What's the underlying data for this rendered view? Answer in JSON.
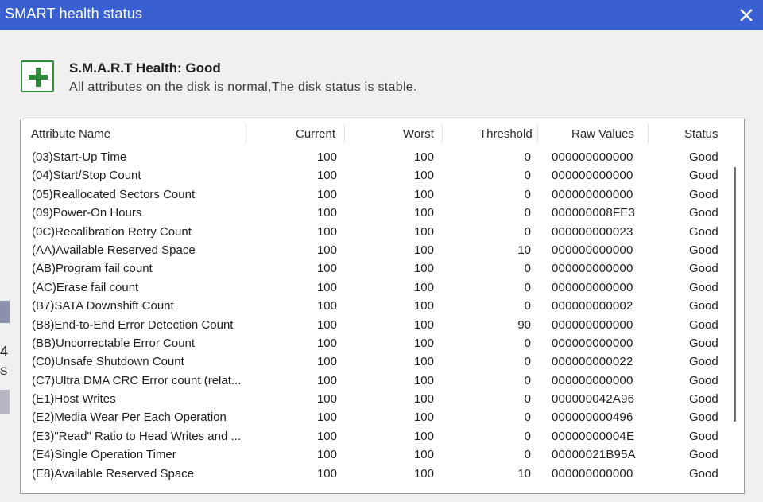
{
  "window": {
    "title": "SMART health status"
  },
  "summary": {
    "title": "S.M.A.R.T Health: Good",
    "description": "All attributes on the disk is normal,The disk status is stable."
  },
  "table": {
    "columns": [
      "Attribute Name",
      "Current",
      "Worst",
      "Threshold",
      "Raw Values",
      "Status"
    ],
    "rows": [
      [
        "(03)Start-Up Time",
        "100",
        "100",
        "0",
        "000000000000",
        "Good"
      ],
      [
        "(04)Start/Stop Count",
        "100",
        "100",
        "0",
        "000000000000",
        "Good"
      ],
      [
        "(05)Reallocated Sectors Count",
        "100",
        "100",
        "0",
        "000000000000",
        "Good"
      ],
      [
        "(09)Power-On Hours",
        "100",
        "100",
        "0",
        "000000008FE3",
        "Good"
      ],
      [
        "(0C)Recalibration Retry Count",
        "100",
        "100",
        "0",
        "000000000023",
        "Good"
      ],
      [
        "(AA)Available Reserved Space",
        "100",
        "100",
        "10",
        "000000000000",
        "Good"
      ],
      [
        "(AB)Program fail count",
        "100",
        "100",
        "0",
        "000000000000",
        "Good"
      ],
      [
        "(AC)Erase fail count",
        "100",
        "100",
        "0",
        "000000000000",
        "Good"
      ],
      [
        "(B7)SATA Downshift Count",
        "100",
        "100",
        "0",
        "000000000002",
        "Good"
      ],
      [
        "(B8)End-to-End Error Detection Count",
        "100",
        "100",
        "90",
        "000000000000",
        "Good"
      ],
      [
        "(BB)Uncorrectable Error Count",
        "100",
        "100",
        "0",
        "000000000000",
        "Good"
      ],
      [
        "(C0)Unsafe Shutdown Count",
        "100",
        "100",
        "0",
        "000000000022",
        "Good"
      ],
      [
        "(C7)Ultra DMA CRC Error count (relat...",
        "100",
        "100",
        "0",
        "000000000000",
        "Good"
      ],
      [
        "(E1)Host Writes",
        "100",
        "100",
        "0",
        "000000042A96",
        "Good"
      ],
      [
        "(E2)Media Wear Per Each Operation",
        "100",
        "100",
        "0",
        "000000000496",
        "Good"
      ],
      [
        "(E3)\"Read\" Ratio to Head Writes and ...",
        "100",
        "100",
        "0",
        "00000000004E",
        "Good"
      ],
      [
        "(E4)Single Operation Timer",
        "100",
        "100",
        "0",
        "00000021B95A",
        "Good"
      ],
      [
        "(E8)Available Reserved Space",
        "100",
        "100",
        "10",
        "000000000000",
        "Good"
      ]
    ]
  },
  "background_fragments": {
    "glyph1": "4",
    "glyph2": "S"
  },
  "colors": {
    "titlebar": "#3a5fd1",
    "good_icon": "#2e8b3a"
  },
  "icons": {
    "close": "close-icon",
    "health": "plus-icon"
  }
}
